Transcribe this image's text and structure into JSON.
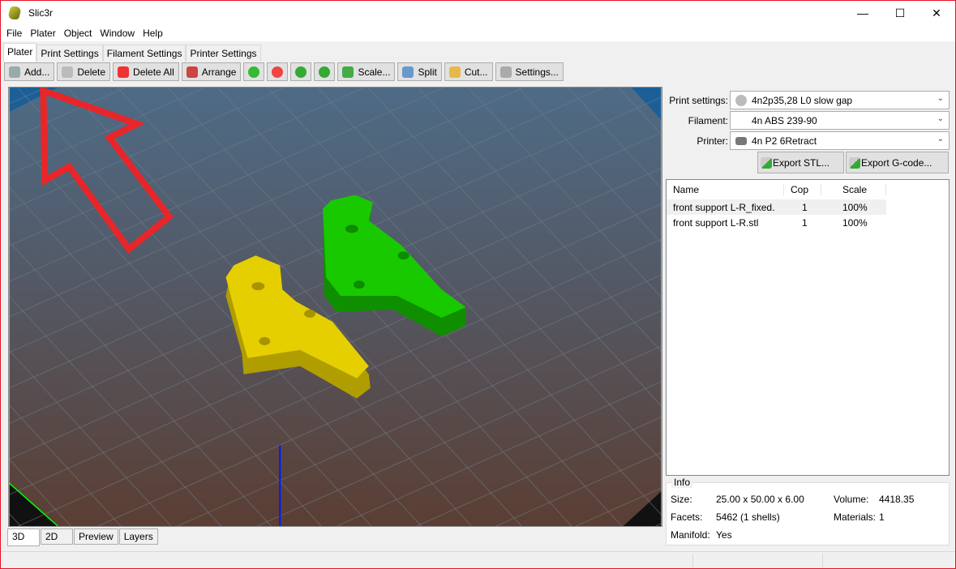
{
  "window": {
    "title": "Slic3r",
    "minimize": "—",
    "maximize": "☐",
    "close": "✕"
  },
  "menu": [
    "File",
    "Plater",
    "Object",
    "Window",
    "Help"
  ],
  "tabs": [
    "Plater",
    "Print Settings",
    "Filament Settings",
    "Printer Settings"
  ],
  "toolbar": [
    {
      "label": "Add...",
      "icon": "add-icon",
      "color": "#9aa"
    },
    {
      "label": "Delete",
      "icon": "delete-icon",
      "color": "#bbb"
    },
    {
      "label": "Delete All",
      "icon": "delete-all-icon",
      "color": "#e33"
    },
    {
      "label": "Arrange",
      "icon": "arrange-icon",
      "color": "#c44"
    },
    {
      "label": "",
      "icon": "increase-icon",
      "color": "#3b3"
    },
    {
      "label": "",
      "icon": "decrease-icon",
      "color": "#e44"
    },
    {
      "label": "",
      "icon": "rotate-left-icon",
      "color": "#3a3"
    },
    {
      "label": "",
      "icon": "rotate-right-icon",
      "color": "#3a3"
    },
    {
      "label": "Scale...",
      "icon": "scale-icon",
      "color": "#4a4"
    },
    {
      "label": "Split",
      "icon": "split-icon",
      "color": "#69c"
    },
    {
      "label": "Cut...",
      "icon": "cut-icon",
      "color": "#e9b84a"
    },
    {
      "label": "Settings...",
      "icon": "settings-icon",
      "color": "#aaa"
    }
  ],
  "view_tabs": [
    "3D",
    "2D",
    "Preview",
    "Layers"
  ],
  "settings": {
    "print_label": "Print settings:",
    "print_value": "4n2p35,28 L0 slow gap",
    "filament_label": "Filament:",
    "filament_value": "4n ABS 239-90",
    "printer_label": "Printer:",
    "printer_value": "4n P2 6Retract",
    "export_stl": "Export STL...",
    "export_gcode": "Export G-code..."
  },
  "objects": {
    "columns": [
      "Name",
      "Cop",
      "Scale"
    ],
    "rows": [
      {
        "name": "front support L-R_fixed.",
        "copies": "1",
        "scale": "100%"
      },
      {
        "name": "front support L-R.stl",
        "copies": "1",
        "scale": "100%"
      }
    ]
  },
  "info": {
    "title": "Info",
    "size_label": "Size:",
    "size": "25.00 x 50.00 x 6.00",
    "volume_label": "Volume:",
    "volume": "4418.35",
    "facets_label": "Facets:",
    "facets": "5462 (1 shells)",
    "materials_label": "Materials:",
    "materials": "1",
    "manifold_label": "Manifold:",
    "manifold": "Yes"
  },
  "colors": {
    "part1": "#e6cf00",
    "part2": "#19c900",
    "arrow": "#e8262a"
  }
}
